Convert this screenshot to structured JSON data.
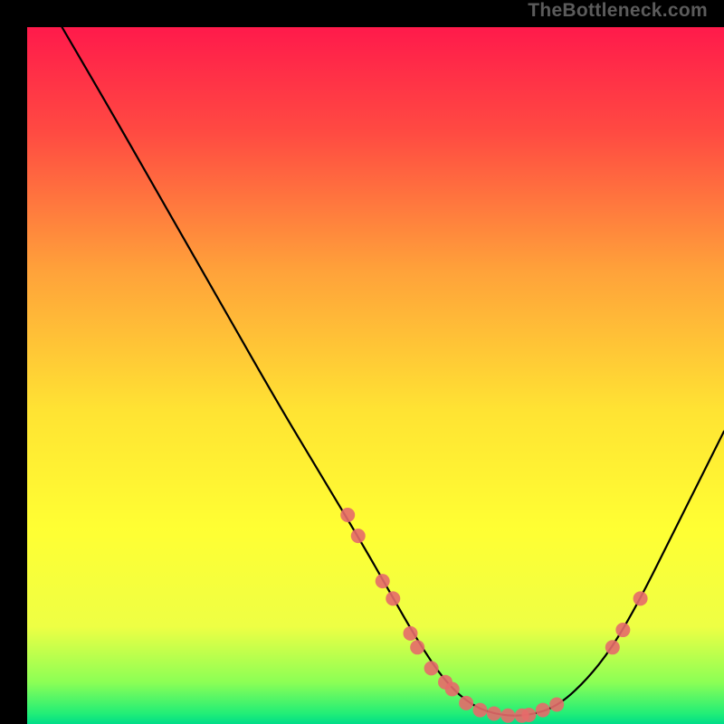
{
  "watermark": "TheBottleneck.com",
  "chart_data": {
    "type": "line",
    "title": "",
    "xlabel": "",
    "ylabel": "",
    "xlim": [
      0,
      100
    ],
    "ylim": [
      0,
      100
    ],
    "gradient_stops": [
      {
        "offset": 0,
        "color": "#ff1a4b"
      },
      {
        "offset": 0.15,
        "color": "#ff4a42"
      },
      {
        "offset": 0.35,
        "color": "#ffa23a"
      },
      {
        "offset": 0.55,
        "color": "#ffe333"
      },
      {
        "offset": 0.72,
        "color": "#ffff33"
      },
      {
        "offset": 0.86,
        "color": "#eeff44"
      },
      {
        "offset": 0.94,
        "color": "#8cff55"
      },
      {
        "offset": 0.985,
        "color": "#22ee77"
      },
      {
        "offset": 1.0,
        "color": "#00dd88"
      }
    ],
    "curve_points": [
      {
        "x": 5,
        "y": 100
      },
      {
        "x": 12,
        "y": 88
      },
      {
        "x": 20,
        "y": 74
      },
      {
        "x": 28,
        "y": 60
      },
      {
        "x": 36,
        "y": 46
      },
      {
        "x": 42,
        "y": 36
      },
      {
        "x": 48,
        "y": 26
      },
      {
        "x": 52,
        "y": 19
      },
      {
        "x": 56,
        "y": 12
      },
      {
        "x": 60,
        "y": 6
      },
      {
        "x": 64,
        "y": 2.5
      },
      {
        "x": 68,
        "y": 1.2
      },
      {
        "x": 72,
        "y": 1.2
      },
      {
        "x": 76,
        "y": 2.5
      },
      {
        "x": 80,
        "y": 6
      },
      {
        "x": 84,
        "y": 11
      },
      {
        "x": 88,
        "y": 18
      },
      {
        "x": 92,
        "y": 26
      },
      {
        "x": 96,
        "y": 34
      },
      {
        "x": 100,
        "y": 42
      }
    ],
    "marker_points": [
      {
        "x": 46,
        "y": 30
      },
      {
        "x": 47.5,
        "y": 27
      },
      {
        "x": 51,
        "y": 20.5
      },
      {
        "x": 52.5,
        "y": 18
      },
      {
        "x": 55,
        "y": 13
      },
      {
        "x": 56,
        "y": 11
      },
      {
        "x": 58,
        "y": 8
      },
      {
        "x": 60,
        "y": 6
      },
      {
        "x": 61,
        "y": 5
      },
      {
        "x": 63,
        "y": 3
      },
      {
        "x": 65,
        "y": 2
      },
      {
        "x": 67,
        "y": 1.5
      },
      {
        "x": 69,
        "y": 1.2
      },
      {
        "x": 71,
        "y": 1.2
      },
      {
        "x": 72,
        "y": 1.3
      },
      {
        "x": 74,
        "y": 2
      },
      {
        "x": 76,
        "y": 2.8
      },
      {
        "x": 84,
        "y": 11
      },
      {
        "x": 85.5,
        "y": 13.5
      },
      {
        "x": 88,
        "y": 18
      }
    ],
    "marker_color": "#e66a6a",
    "marker_radius": 8,
    "curve_color": "#000000",
    "curve_width": 2.2
  }
}
